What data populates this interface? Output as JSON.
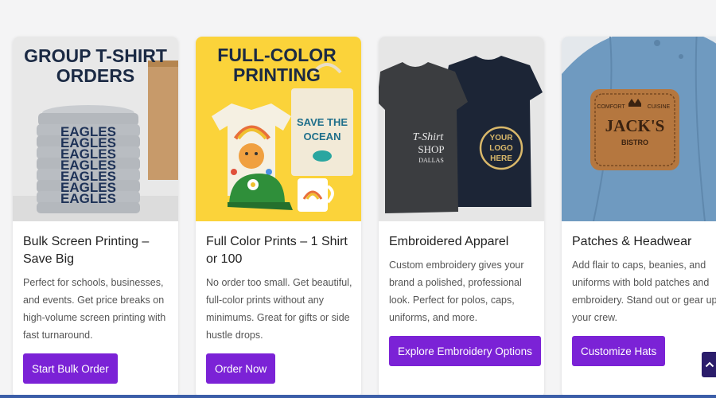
{
  "cards": [
    {
      "image": {
        "headline_line1": "GROUP T-SHIRT",
        "headline_line2": "ORDERS",
        "shirt_text": "EAGLES"
      },
      "title": "Bulk Screen Printing – Save Big",
      "description": "Perfect for schools, businesses, and events. Get price breaks on high-volume screen printing with fast turnaround.",
      "button": "Start Bulk Order"
    },
    {
      "image": {
        "headline_line1": "FULL-COLOR",
        "headline_line2": "PRINTING",
        "tote_line1": "SAVE THE",
        "tote_line2": "OCEAN"
      },
      "title": "Full Color Prints – 1 Shirt or 100",
      "description": "No order too small. Get beautiful, full-color prints without any minimums. Great for gifts or side hustle drops.",
      "button": "Order Now"
    },
    {
      "image": {
        "shirt_line1": "T-Shirt",
        "shirt_line2": "SHOP",
        "shirt_line3": "DALLAS",
        "logo_line1": "YOUR",
        "logo_line2": "LOGO",
        "logo_line3": "HERE"
      },
      "title": "Embroidered Apparel",
      "description": "Custom embroidery gives your brand a polished, professional look. Perfect for polos, caps, uniforms, and more.",
      "button": "Explore Embroidery Options"
    },
    {
      "image": {
        "patch_top_left": "COMFORT",
        "patch_top_right": "CUISINE",
        "patch_name": "JACK'S",
        "patch_sub": "BISTRO"
      },
      "title": "Patches & Headwear",
      "description": "Add flair to caps, beanies, and uniforms with bold patches and embroidery. Stand out or gear up your crew.",
      "button": "Customize Hats"
    }
  ],
  "scroll_top_icon": "chevron-up-icon",
  "colors": {
    "button": "#7b22d6",
    "page_background": "#f4f4f5",
    "scroll_top": "#2b1d6b",
    "bottom_bar": "#3b5ea8"
  }
}
